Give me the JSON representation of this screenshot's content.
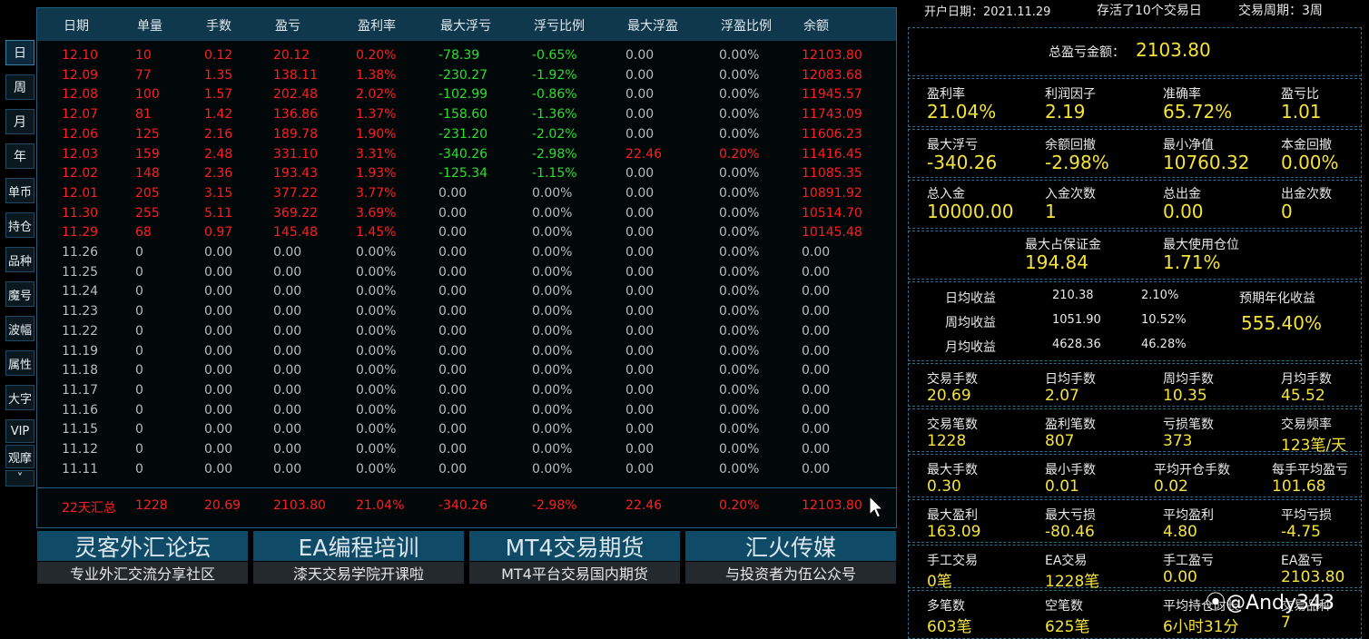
{
  "side_nav": [
    "日",
    "周",
    "月",
    "年",
    "单币",
    "持仓",
    "品种",
    "魔号",
    "波幅",
    "属性",
    "大字",
    "VIP",
    "观摩",
    "˅"
  ],
  "table": {
    "headers": [
      "日期",
      "单量",
      "手数",
      "盈亏",
      "盈利率",
      "最大浮亏",
      "浮亏比例",
      "最大浮盈",
      "浮盈比例",
      "余额"
    ],
    "rows": [
      [
        "12.10",
        "10",
        "0.12",
        "20.12",
        "0.20%",
        "-78.39",
        "-0.65%",
        "0.00",
        "0.00%",
        "12103.80"
      ],
      [
        "12.09",
        "77",
        "1.35",
        "138.11",
        "1.38%",
        "-230.27",
        "-1.92%",
        "0.00",
        "0.00%",
        "12083.68"
      ],
      [
        "12.08",
        "100",
        "1.57",
        "202.48",
        "2.02%",
        "-102.99",
        "-0.86%",
        "0.00",
        "0.00%",
        "11945.57"
      ],
      [
        "12.07",
        "81",
        "1.42",
        "136.86",
        "1.37%",
        "-158.60",
        "-1.36%",
        "0.00",
        "0.00%",
        "11743.09"
      ],
      [
        "12.06",
        "125",
        "2.16",
        "189.78",
        "1.90%",
        "-231.20",
        "-2.02%",
        "0.00",
        "0.00%",
        "11606.23"
      ],
      [
        "12.03",
        "159",
        "2.48",
        "331.10",
        "3.31%",
        "-340.26",
        "-2.98%",
        "22.46",
        "0.20%",
        "11416.45"
      ],
      [
        "12.02",
        "148",
        "2.36",
        "193.43",
        "1.93%",
        "-125.34",
        "-1.15%",
        "0.00",
        "0.00%",
        "11085.35"
      ],
      [
        "12.01",
        "205",
        "3.15",
        "377.22",
        "3.77%",
        "0.00",
        "0.00%",
        "0.00",
        "0.00%",
        "10891.92"
      ],
      [
        "11.30",
        "255",
        "5.11",
        "369.22",
        "3.69%",
        "0.00",
        "0.00%",
        "0.00",
        "0.00%",
        "10514.70"
      ],
      [
        "11.29",
        "68",
        "0.97",
        "145.48",
        "1.45%",
        "0.00",
        "0.00%",
        "0.00",
        "0.00%",
        "10145.48"
      ],
      [
        "11.26",
        "0",
        "0.00",
        "0.00",
        "0.00%",
        "0.00",
        "0.00%",
        "0.00",
        "0.00%",
        "0.00"
      ],
      [
        "11.25",
        "0",
        "0.00",
        "0.00",
        "0.00%",
        "0.00",
        "0.00%",
        "0.00",
        "0.00%",
        "0.00"
      ],
      [
        "11.24",
        "0",
        "0.00",
        "0.00",
        "0.00%",
        "0.00",
        "0.00%",
        "0.00",
        "0.00%",
        "0.00"
      ],
      [
        "11.23",
        "0",
        "0.00",
        "0.00",
        "0.00%",
        "0.00",
        "0.00%",
        "0.00",
        "0.00%",
        "0.00"
      ],
      [
        "11.22",
        "0",
        "0.00",
        "0.00",
        "0.00%",
        "0.00",
        "0.00%",
        "0.00",
        "0.00%",
        "0.00"
      ],
      [
        "11.19",
        "0",
        "0.00",
        "0.00",
        "0.00%",
        "0.00",
        "0.00%",
        "0.00",
        "0.00%",
        "0.00"
      ],
      [
        "11.18",
        "0",
        "0.00",
        "0.00",
        "0.00%",
        "0.00",
        "0.00%",
        "0.00",
        "0.00%",
        "0.00"
      ],
      [
        "11.17",
        "0",
        "0.00",
        "0.00",
        "0.00%",
        "0.00",
        "0.00%",
        "0.00",
        "0.00%",
        "0.00"
      ],
      [
        "11.16",
        "0",
        "0.00",
        "0.00",
        "0.00%",
        "0.00",
        "0.00%",
        "0.00",
        "0.00%",
        "0.00"
      ],
      [
        "11.15",
        "0",
        "0.00",
        "0.00",
        "0.00%",
        "0.00",
        "0.00%",
        "0.00",
        "0.00%",
        "0.00"
      ],
      [
        "11.12",
        "0",
        "0.00",
        "0.00",
        "0.00%",
        "0.00",
        "0.00%",
        "0.00",
        "0.00%",
        "0.00"
      ],
      [
        "11.11",
        "0",
        "0.00",
        "0.00",
        "0.00%",
        "0.00",
        "0.00%",
        "0.00",
        "0.00%",
        "0.00"
      ]
    ],
    "summary": [
      "22天汇总",
      "1228",
      "20.69",
      "2103.80",
      "21.04%",
      "-340.26",
      "-2.98%",
      "22.46",
      "0.20%",
      "12103.80"
    ]
  },
  "banners": [
    {
      "title": "灵客外汇论坛",
      "subtitle": "专业外汇交流分享社区"
    },
    {
      "title": "EA编程培训",
      "subtitle": "漆天交易学院开课啦"
    },
    {
      "title": "MT4交易期货",
      "subtitle": "MT4平台交易国内期货"
    },
    {
      "title": "汇火传媒",
      "subtitle": "与投资者为伍公众号"
    }
  ],
  "stats": {
    "open_date": "开户日期：2021.11.29",
    "alive": "存活了10个交易日",
    "period": "交易周期：3周",
    "total_pl_label": "总盈亏金额：",
    "total_pl_value": "2103.80",
    "g1": [
      [
        "盈利率",
        "21.04%"
      ],
      [
        "利润因子",
        "2.19"
      ],
      [
        "准确率",
        "65.72%"
      ],
      [
        "盈亏比",
        "1.01"
      ]
    ],
    "g2": [
      [
        "最大浮亏",
        "-340.26"
      ],
      [
        "余额回撤",
        "-2.98%"
      ],
      [
        "最小净值",
        "10760.32"
      ],
      [
        "本金回撤",
        "0.00%"
      ]
    ],
    "g3": [
      [
        "总入金",
        "10000.00"
      ],
      [
        "入金次数",
        "1"
      ],
      [
        "总出金",
        "0.00"
      ],
      [
        "出金次数",
        "0"
      ]
    ],
    "g4": [
      [
        "最大占保证金",
        "194.84"
      ],
      [
        "最大使用仓位",
        "1.71%"
      ]
    ],
    "avg": {
      "rows": [
        [
          "日均收益",
          "210.38",
          "2.10%"
        ],
        [
          "周均收益",
          "1051.90",
          "10.52%"
        ],
        [
          "月均收益",
          "4628.36",
          "46.28%"
        ]
      ],
      "annual_label": "预期年化收益",
      "annual_value": "555.40%"
    },
    "g5": [
      [
        "交易手数",
        "20.69"
      ],
      [
        "日均手数",
        "2.07"
      ],
      [
        "周均手数",
        "10.35"
      ],
      [
        "月均手数",
        "45.52"
      ]
    ],
    "g6": [
      [
        "交易笔数",
        "1228"
      ],
      [
        "盈利笔数",
        "807"
      ],
      [
        "亏损笔数",
        "373"
      ],
      [
        "交易频率",
        "123笔/天"
      ]
    ],
    "g7": [
      [
        "最大手数",
        "0.30"
      ],
      [
        "最小手数",
        "0.01"
      ],
      [
        "平均开仓手数",
        "0.02"
      ],
      [
        "每手平均盈亏",
        "101.68"
      ]
    ],
    "g8": [
      [
        "最大盈利",
        "163.09"
      ],
      [
        "最大亏损",
        "-80.46"
      ],
      [
        "平均盈利",
        "4.80"
      ],
      [
        "平均亏损",
        "-4.75"
      ]
    ],
    "g9": [
      [
        "手工交易",
        "0笔"
      ],
      [
        "EA交易",
        "1228笔"
      ],
      [
        "手工盈亏",
        "0.00"
      ],
      [
        "EA盈亏",
        "2103.80"
      ]
    ],
    "g10": [
      [
        "多笔数",
        "603笔"
      ],
      [
        "空笔数",
        "625笔"
      ],
      [
        "平均持仓时长",
        "6小时31分"
      ],
      [
        "交易品种",
        "7"
      ]
    ]
  },
  "watermark": "@Andy343",
  "colors": {
    "up": "#ff1f1f",
    "down": "#2be02b",
    "neutral": "#b9bcbe",
    "stat_value": "#f5e33a",
    "header_bg": "#10384d",
    "banner_bg": "#0f4a66"
  }
}
